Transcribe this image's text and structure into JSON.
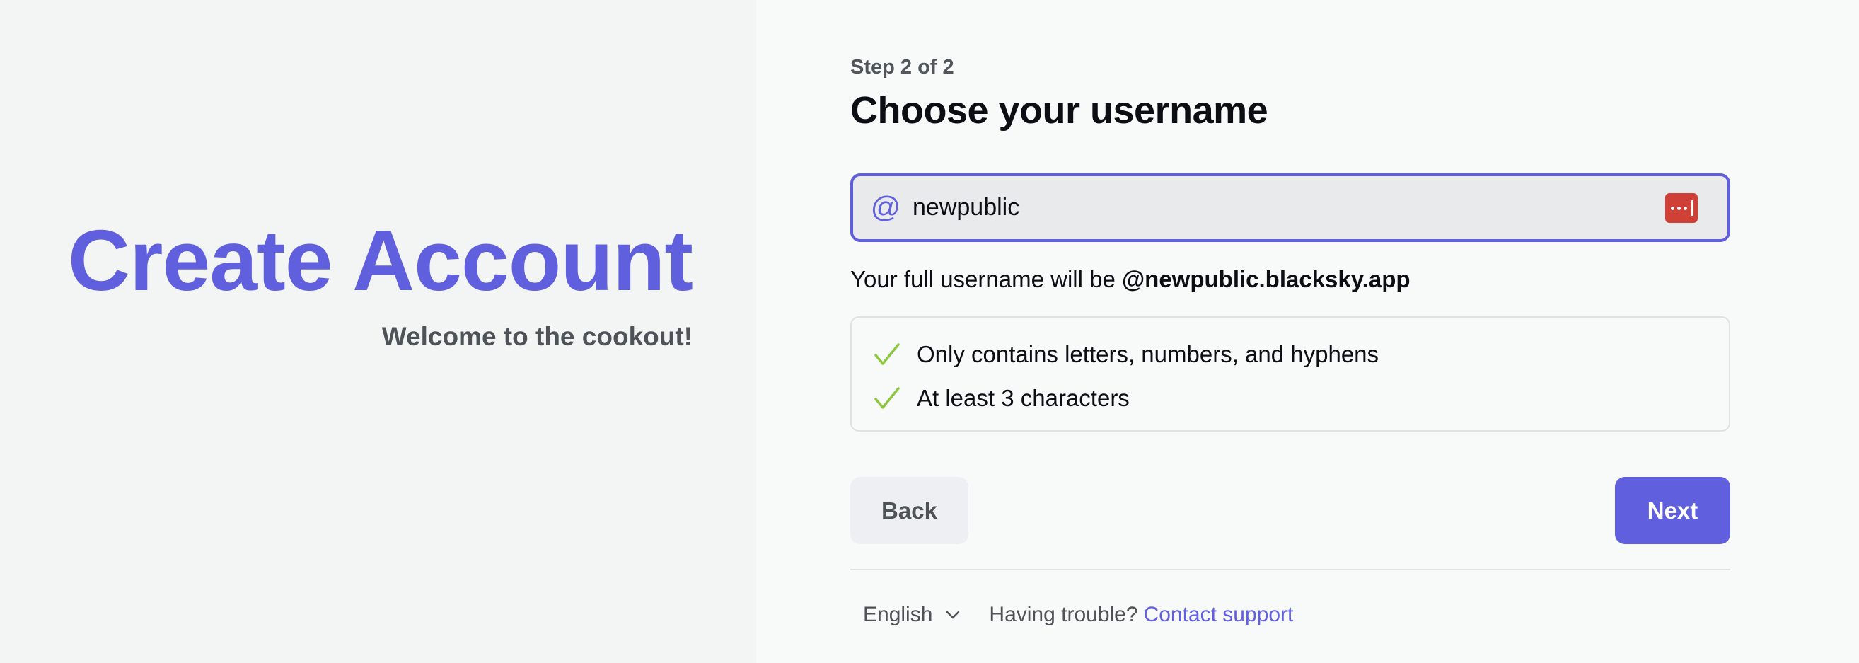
{
  "left": {
    "title": "Create Account",
    "subtitle": "Welcome to the cookout!"
  },
  "form": {
    "step_label": "Step 2 of 2",
    "title": "Choose your username",
    "handle_input": {
      "value": "newpublic",
      "prefix_icon": "at-icon",
      "password_manager_icon": "password-manager-icon"
    },
    "full_handle_prefix": "Your full username will be ",
    "full_handle": "@newpublic.blacksky.app",
    "checks": [
      {
        "text": "Only contains letters, numbers, and hyphens",
        "status": "passed"
      },
      {
        "text": "At least 3 characters",
        "status": "passed"
      }
    ],
    "back_label": "Back",
    "next_label": "Next"
  },
  "footer": {
    "language": "English",
    "trouble_text": "Having trouble?",
    "support_link": "Contact support"
  },
  "colors": {
    "accent": "#6060df",
    "check_green": "#8dc63f",
    "password_manager_red": "#cf4036"
  }
}
